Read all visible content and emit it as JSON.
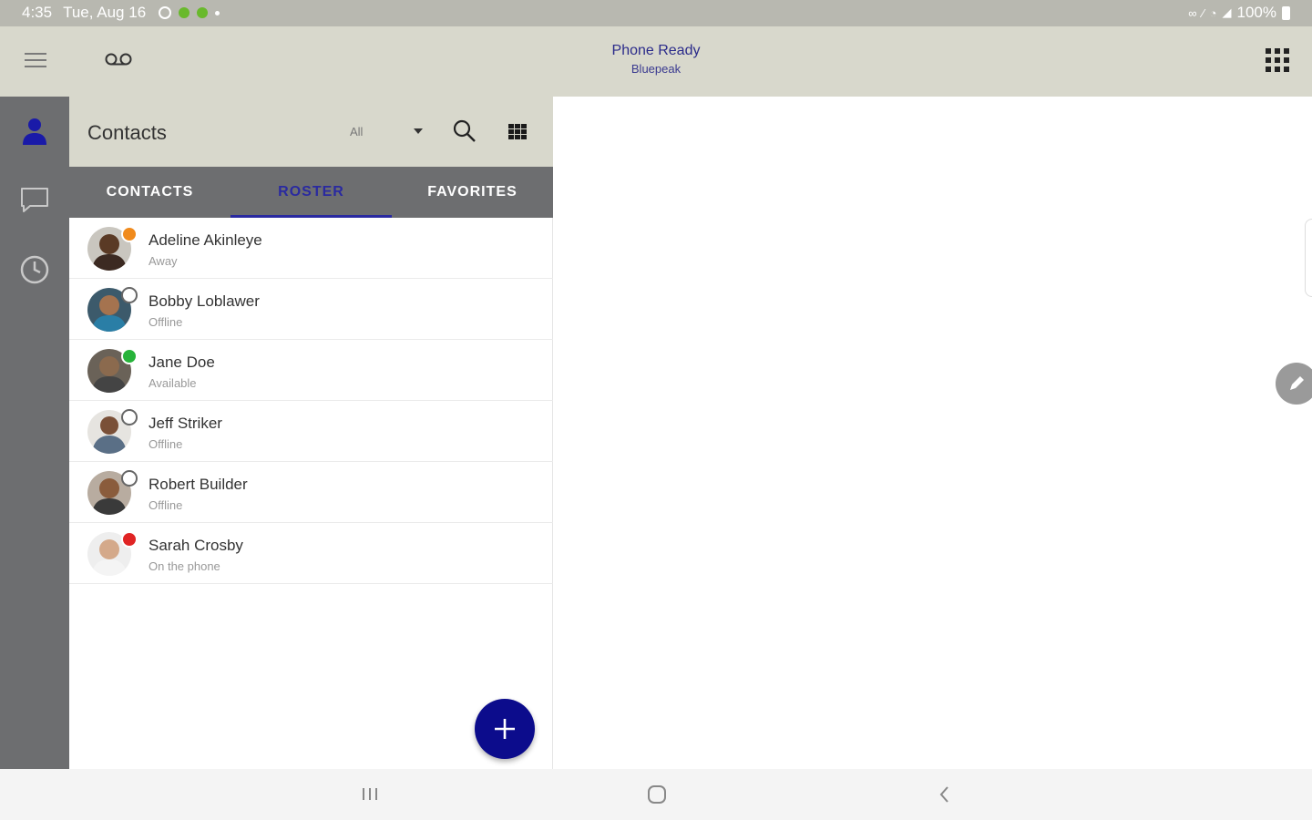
{
  "status_bar": {
    "time": "4:35",
    "date": "Tue, Aug 16",
    "battery": "100%"
  },
  "top_bar": {
    "phone_status": "Phone Ready",
    "phone_substatus": "Bluepeak"
  },
  "rail": {
    "items": [
      {
        "icon": "person-icon",
        "active": true
      },
      {
        "icon": "chat-icon",
        "active": false
      },
      {
        "icon": "history-clock-icon",
        "active": false
      }
    ]
  },
  "contacts_panel": {
    "title": "Contacts",
    "filter": "All",
    "tabs": [
      {
        "label": "CONTACTS",
        "active": false
      },
      {
        "label": "ROSTER",
        "active": true
      },
      {
        "label": "FAVORITES",
        "active": false
      }
    ],
    "contacts": [
      {
        "name": "Adeline Akinleye",
        "status": "Away",
        "presence": "away"
      },
      {
        "name": "Bobby Loblawer",
        "status": "Offline",
        "presence": "offline"
      },
      {
        "name": "Jane Doe",
        "status": "Available",
        "presence": "available"
      },
      {
        "name": "Jeff Striker",
        "status": "Offline",
        "presence": "offline"
      },
      {
        "name": "Robert Builder",
        "status": "Offline",
        "presence": "offline"
      },
      {
        "name": "Sarah Crosby",
        "status": "On the phone",
        "presence": "busy"
      }
    ]
  },
  "colors": {
    "accent": "#0c0c8c",
    "rail": "#6d6e70",
    "header": "#d8d8cc",
    "away": "#f08a1c",
    "available": "#27b33a",
    "busy": "#e02424"
  }
}
